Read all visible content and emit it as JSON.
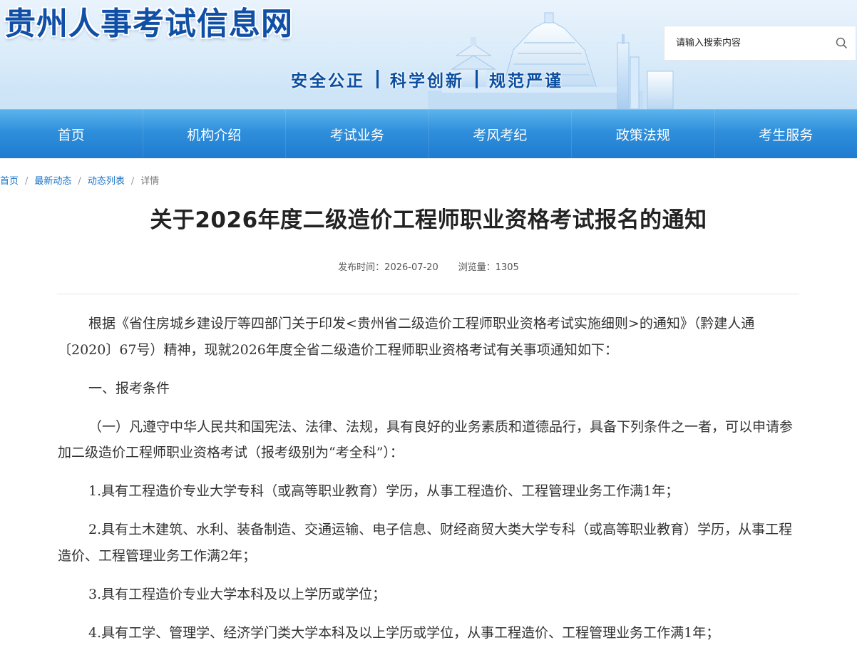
{
  "header": {
    "site_title": "贵州人事考试信息网",
    "slogan": [
      "安全公正",
      "科学创新",
      "规范严谨"
    ],
    "search": {
      "placeholder": "请输入搜索内容",
      "icon": "search-icon"
    }
  },
  "nav": {
    "items": [
      "首页",
      "机构介绍",
      "考试业务",
      "考风考纪",
      "政策法规",
      "考生服务"
    ]
  },
  "breadcrumb": {
    "items": [
      "首页",
      "最新动态",
      "动态列表"
    ],
    "current": "详情"
  },
  "article": {
    "title": "关于2026年度二级造价工程师职业资格考试报名的通知",
    "publish_time": "发布时间：2026-07-20",
    "views": "浏览量：1305",
    "paragraphs": [
      "根据《省住房城乡建设厅等四部门关于印发<贵州省二级造价工程师职业资格考试实施细则>的通知》（黔建人通〔2020〕67号）精神，现就2026年度全省二级造价工程师职业资格考试有关事项通知如下：",
      "一、报考条件",
      "（一）凡遵守中华人民共和国宪法、法律、法规，具有良好的业务素质和道德品行，具备下列条件之一者，可以申请参加二级造价工程师职业资格考试（报考级别为“考全科”）：",
      "1.具有工程造价专业大学专科（或高等职业教育）学历，从事工程造价、工程管理业务工作满1年；",
      "2.具有土木建筑、水利、装备制造、交通运输、电子信息、财经商贸大类大学专科（或高等职业教育）学历，从事工程造价、工程管理业务工作满2年；",
      "3.具有工程造价专业大学本科及以上学历或学位；",
      "4.具有工学、管理学、经济学门类大学本科及以上学历或学位，从事工程造价、工程管理业务工作满1年；"
    ]
  },
  "colors": {
    "nav_top": "#5bb3ec",
    "nav_bottom": "#1f7bd0",
    "title_blue": "#0f4fa6",
    "link_blue": "#1a73c8"
  }
}
